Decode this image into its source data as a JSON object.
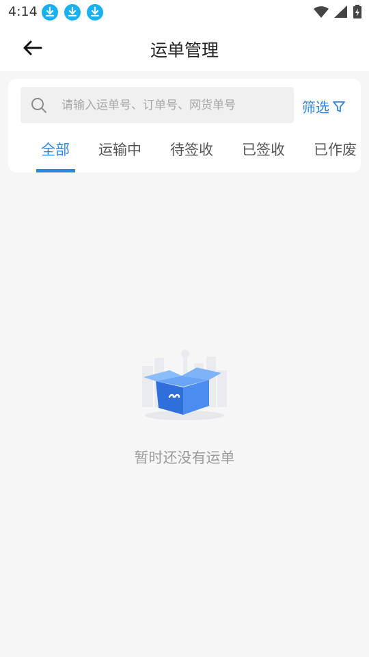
{
  "status_bar": {
    "time": "4:14",
    "notification_icons": [
      "download-icon",
      "download-icon",
      "download-icon"
    ],
    "system_icons": [
      "wifi-icon",
      "signal-icon",
      "battery-charging-icon"
    ]
  },
  "header": {
    "back_icon": "arrow-left-icon",
    "title": "运单管理"
  },
  "search": {
    "placeholder": "请输入运单号、订单号、网货单号",
    "value": ""
  },
  "filter": {
    "label": "筛选",
    "icon": "filter-icon"
  },
  "tabs": [
    {
      "label": "全部",
      "active": true
    },
    {
      "label": "运输中",
      "active": false
    },
    {
      "label": "待签收",
      "active": false
    },
    {
      "label": "已签收",
      "active": false
    },
    {
      "label": "已作废",
      "active": false
    }
  ],
  "empty_state": {
    "icon": "empty-box-icon",
    "message": "暂时还没有运单"
  },
  "colors": {
    "accent": "#2f86e0",
    "background": "#f6f6f7",
    "notification_badge": "#18b0f0"
  }
}
